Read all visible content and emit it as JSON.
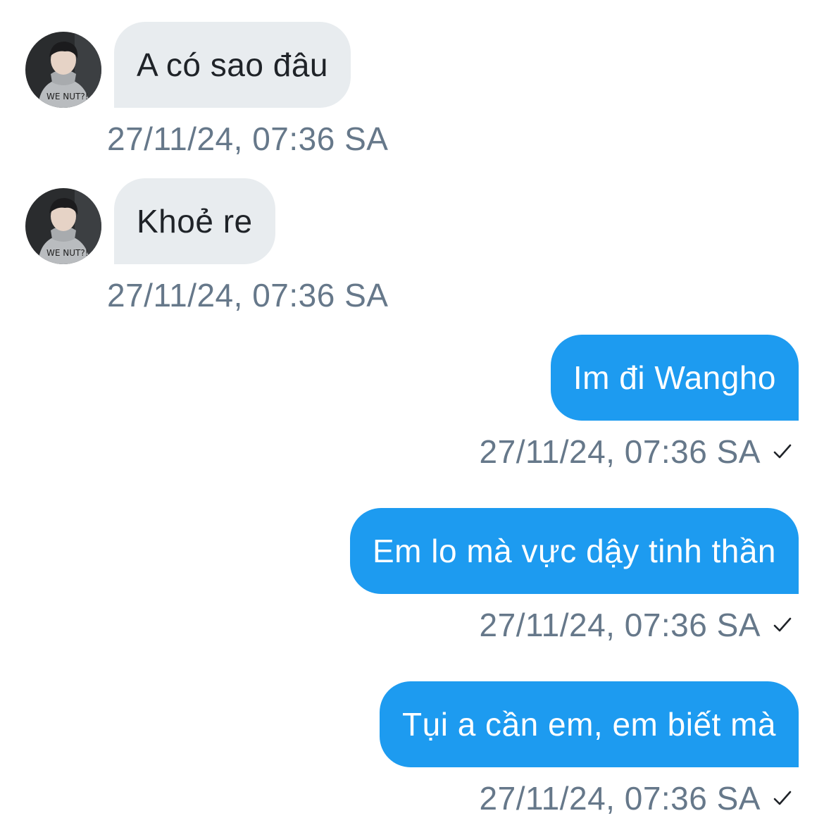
{
  "messages": [
    {
      "direction": "in",
      "text": "A có sao đâu",
      "timestamp": "27/11/24, 07:36 SA"
    },
    {
      "direction": "in",
      "text": "Khoẻ re",
      "timestamp": "27/11/24, 07:36 SA"
    },
    {
      "direction": "out",
      "text": "Im đi Wangho",
      "timestamp": "27/11/24, 07:36 SA",
      "status_icon": "checkmark-icon"
    },
    {
      "direction": "out",
      "text": "Em lo mà vực dậy tinh thần",
      "timestamp": "27/11/24, 07:36 SA",
      "status_icon": "checkmark-icon"
    },
    {
      "direction": "out",
      "text": "Tụi a cần em, em biết mà",
      "timestamp": "27/11/24, 07:36 SA",
      "status_icon": "checkmark-icon"
    }
  ],
  "colors": {
    "incoming_bubble": "#e8ecef",
    "outgoing_bubble": "#1d9bf0",
    "timestamp": "#66788a"
  }
}
